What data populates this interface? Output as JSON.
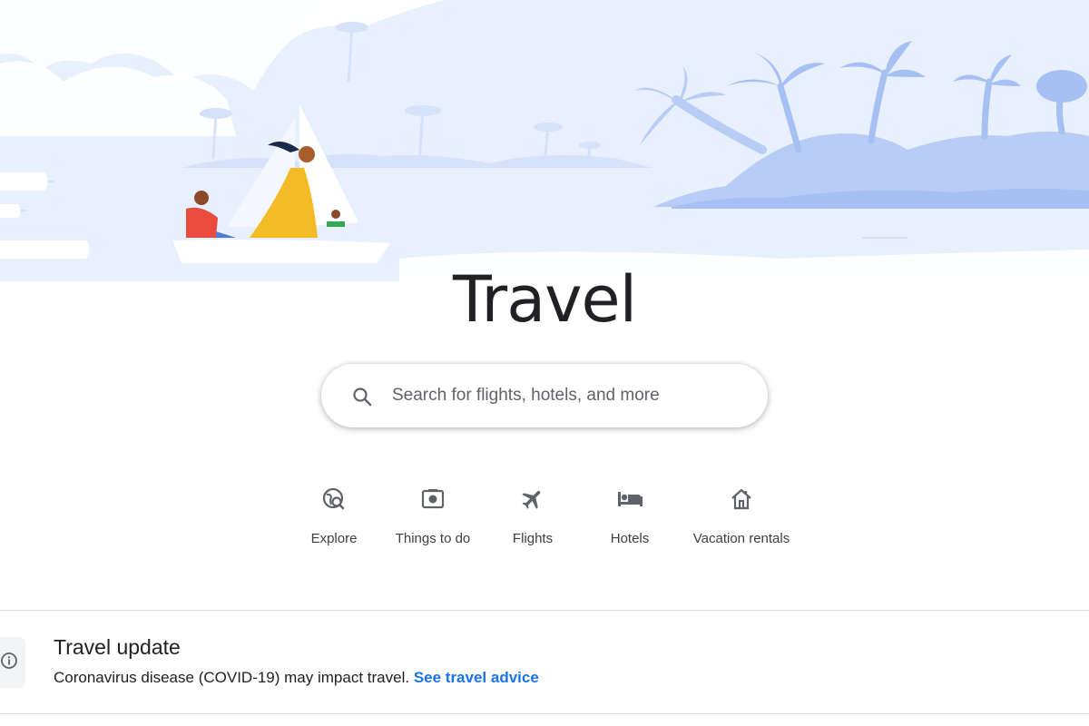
{
  "page": {
    "title": "Travel"
  },
  "search": {
    "placeholder": "Search for flights, hotels, and more",
    "icon": "search-icon"
  },
  "categories": [
    {
      "label": "Explore",
      "icon": "explore-globe-icon"
    },
    {
      "label": "Things to do",
      "icon": "camera-icon"
    },
    {
      "label": "Flights",
      "icon": "airplane-icon"
    },
    {
      "label": "Hotels",
      "icon": "bed-icon"
    },
    {
      "label": "Vacation rentals",
      "icon": "house-icon"
    }
  ],
  "update": {
    "title": "Travel update",
    "text": "Coronavirus disease (COVID-19) may impact travel.",
    "link_label": "See travel advice",
    "icon": "info-icon"
  },
  "colors": {
    "hero_sky": "#e8effd",
    "hero_shapes": "#b8cdf6",
    "accent_link": "#1a73e8",
    "icon_gray": "#5f6368",
    "text_primary": "#202124"
  }
}
